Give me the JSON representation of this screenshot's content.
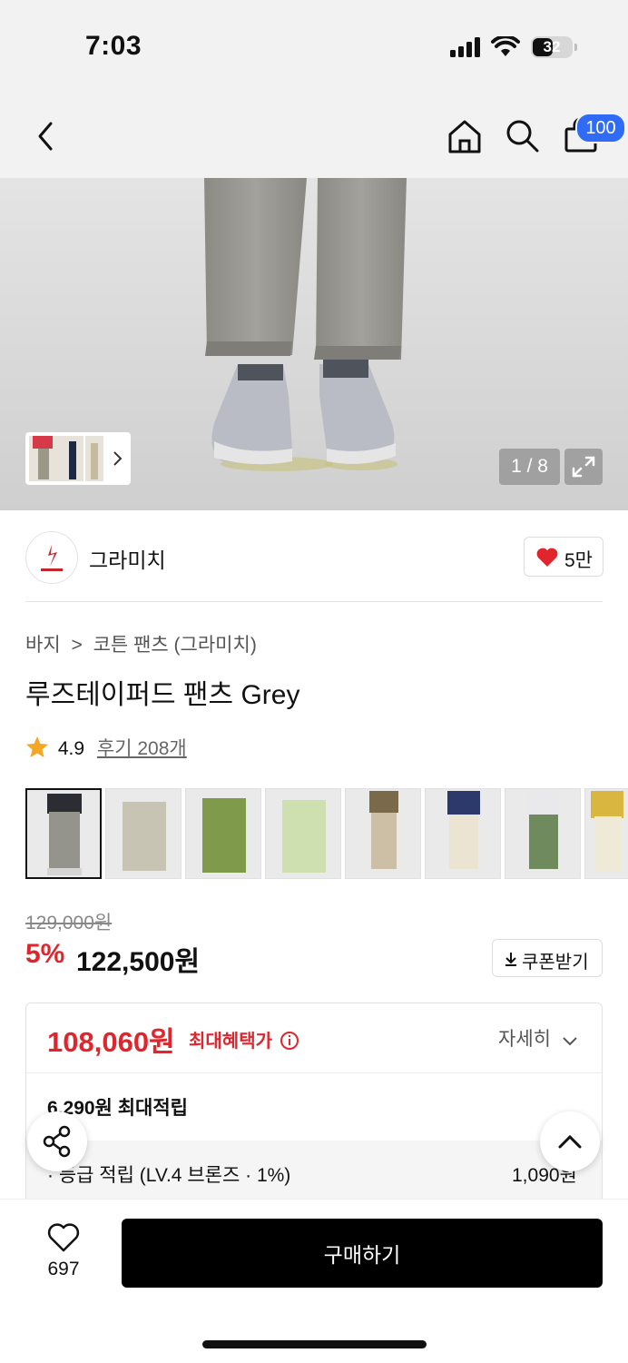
{
  "status": {
    "time": "7:03",
    "battery": "32"
  },
  "nav": {
    "cart_count": "100"
  },
  "hero": {
    "counter": "1 / 8"
  },
  "brand": {
    "name": "그라미치",
    "likes": "5만"
  },
  "breadcrumb": {
    "category": "바지",
    "separator": ">",
    "sub": "코튼 팬츠 (그라미치)"
  },
  "product": {
    "title": "루즈테이퍼드 팬츠 Grey",
    "rating": "4.9",
    "reviews": "후기 208개",
    "original_price": "129,000원",
    "discount": "5%",
    "price": "122,500원",
    "coupon_label": "쿠폰받기"
  },
  "benefit": {
    "max_price": "108,060원",
    "max_label": "최대혜택가",
    "detail_label": "자세히",
    "points_title": "6,290원 최대적립",
    "grade_label": "· 등급 적립 (LV.4 브론즈 · 1%)",
    "grade_amount": "1,090원"
  },
  "bottom": {
    "wish_count": "697",
    "buy_label": "구매하기"
  },
  "colors": {
    "accent_red": "#e0262c",
    "badge_blue": "#2f6bf5"
  }
}
